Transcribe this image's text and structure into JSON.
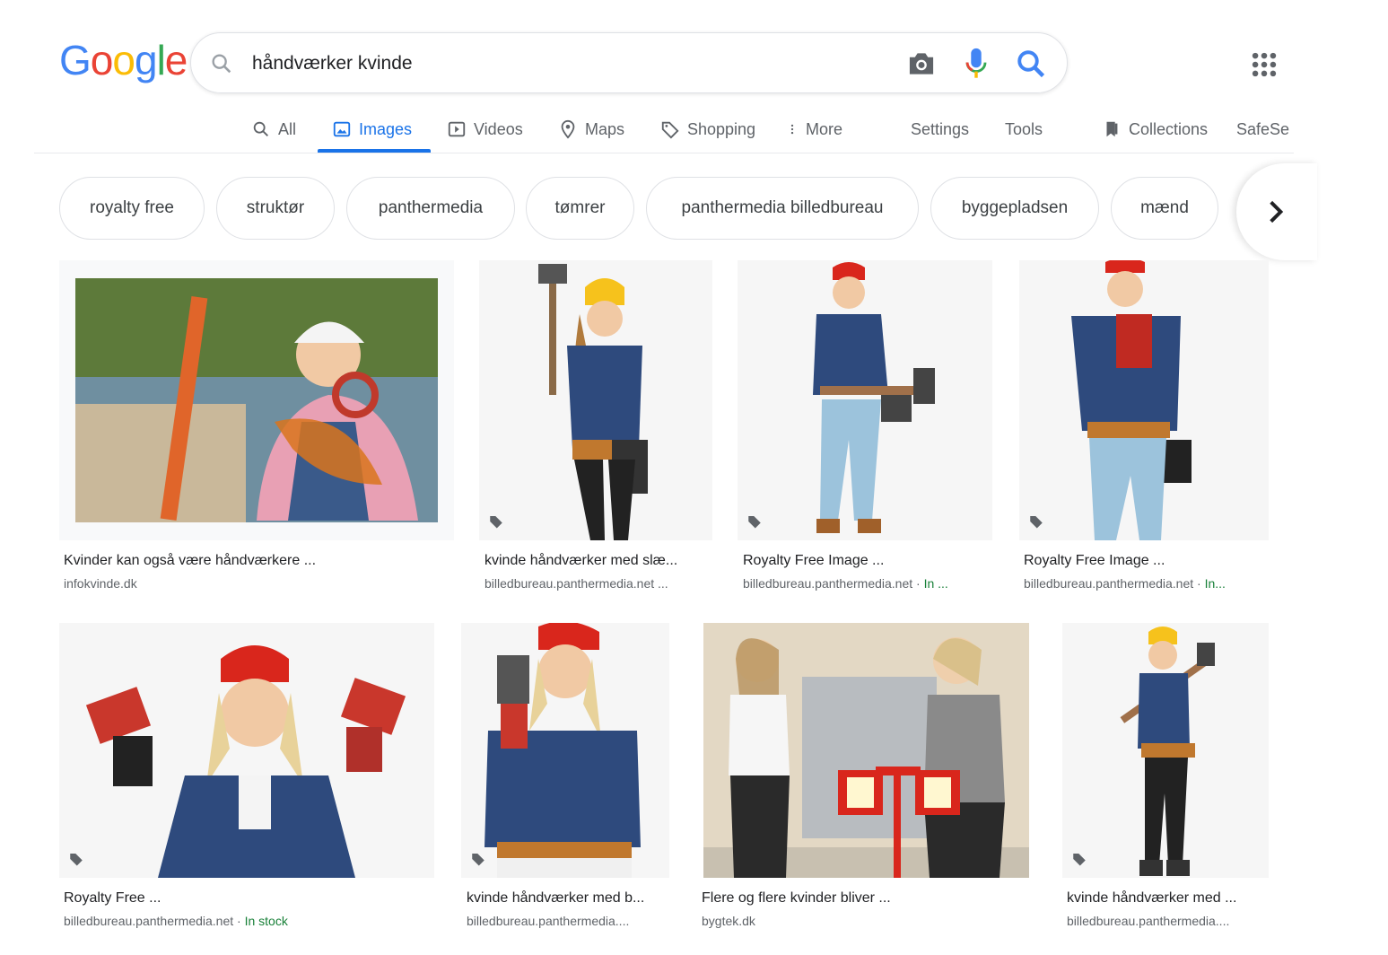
{
  "logo": {
    "letters": [
      "G",
      "o",
      "o",
      "g",
      "l",
      "e"
    ],
    "colors": [
      "#4285f4",
      "#ea4335",
      "#fbbc05",
      "#4285f4",
      "#34a853",
      "#ea4335"
    ]
  },
  "search": {
    "query": "håndværker kvinde"
  },
  "tabs": [
    {
      "label": "All",
      "icon": "search-icon"
    },
    {
      "label": "Images",
      "icon": "image-icon",
      "active": true
    },
    {
      "label": "Videos",
      "icon": "play-icon"
    },
    {
      "label": "Maps",
      "icon": "map-pin-icon"
    },
    {
      "label": "Shopping",
      "icon": "tag-icon"
    },
    {
      "label": "More",
      "icon": "more-vert-icon"
    },
    {
      "label": "Settings"
    },
    {
      "label": "Tools"
    },
    {
      "label": "Collections",
      "icon": "bookmark-icon"
    },
    {
      "label": "SafeSe"
    }
  ],
  "chips": [
    "royalty free",
    "struktør",
    "panthermedia",
    "tømrer",
    "panthermedia billedbureau",
    "byggepladsen",
    "mænd"
  ],
  "results": [
    {
      "title": "Kvinder kan også være håndværkere ...",
      "source": "infokvinde.dk",
      "stock": ""
    },
    {
      "title": "kvinde håndværker med slæ...",
      "source": "billedbureau.panthermedia.net ...",
      "stock": ""
    },
    {
      "title": "Royalty Free Image ...",
      "source": "billedbureau.panthermedia.net · ",
      "stock": "In ..."
    },
    {
      "title": "Royalty Free Image ...",
      "source": "billedbureau.panthermedia.net · ",
      "stock": "In..."
    },
    {
      "title": "Royalty Free ...",
      "source": "billedbureau.panthermedia.net · ",
      "stock": "In stock"
    },
    {
      "title": "kvinde håndværker med b...",
      "source": "billedbureau.panthermedia....",
      "stock": ""
    },
    {
      "title": "Flere og flere kvinder bliver ...",
      "source": "bygtek.dk",
      "stock": ""
    },
    {
      "title": "kvinde håndværker med ...",
      "source": "billedbureau.panthermedia....",
      "stock": ""
    }
  ],
  "colors": {
    "accent": "#1a73e8",
    "stock": "#188038",
    "helmet_yellow": "#f6c21c",
    "helmet_red": "#d9261c",
    "helmet_white": "#f4f4f4",
    "plaid": "#2e4a7d"
  }
}
